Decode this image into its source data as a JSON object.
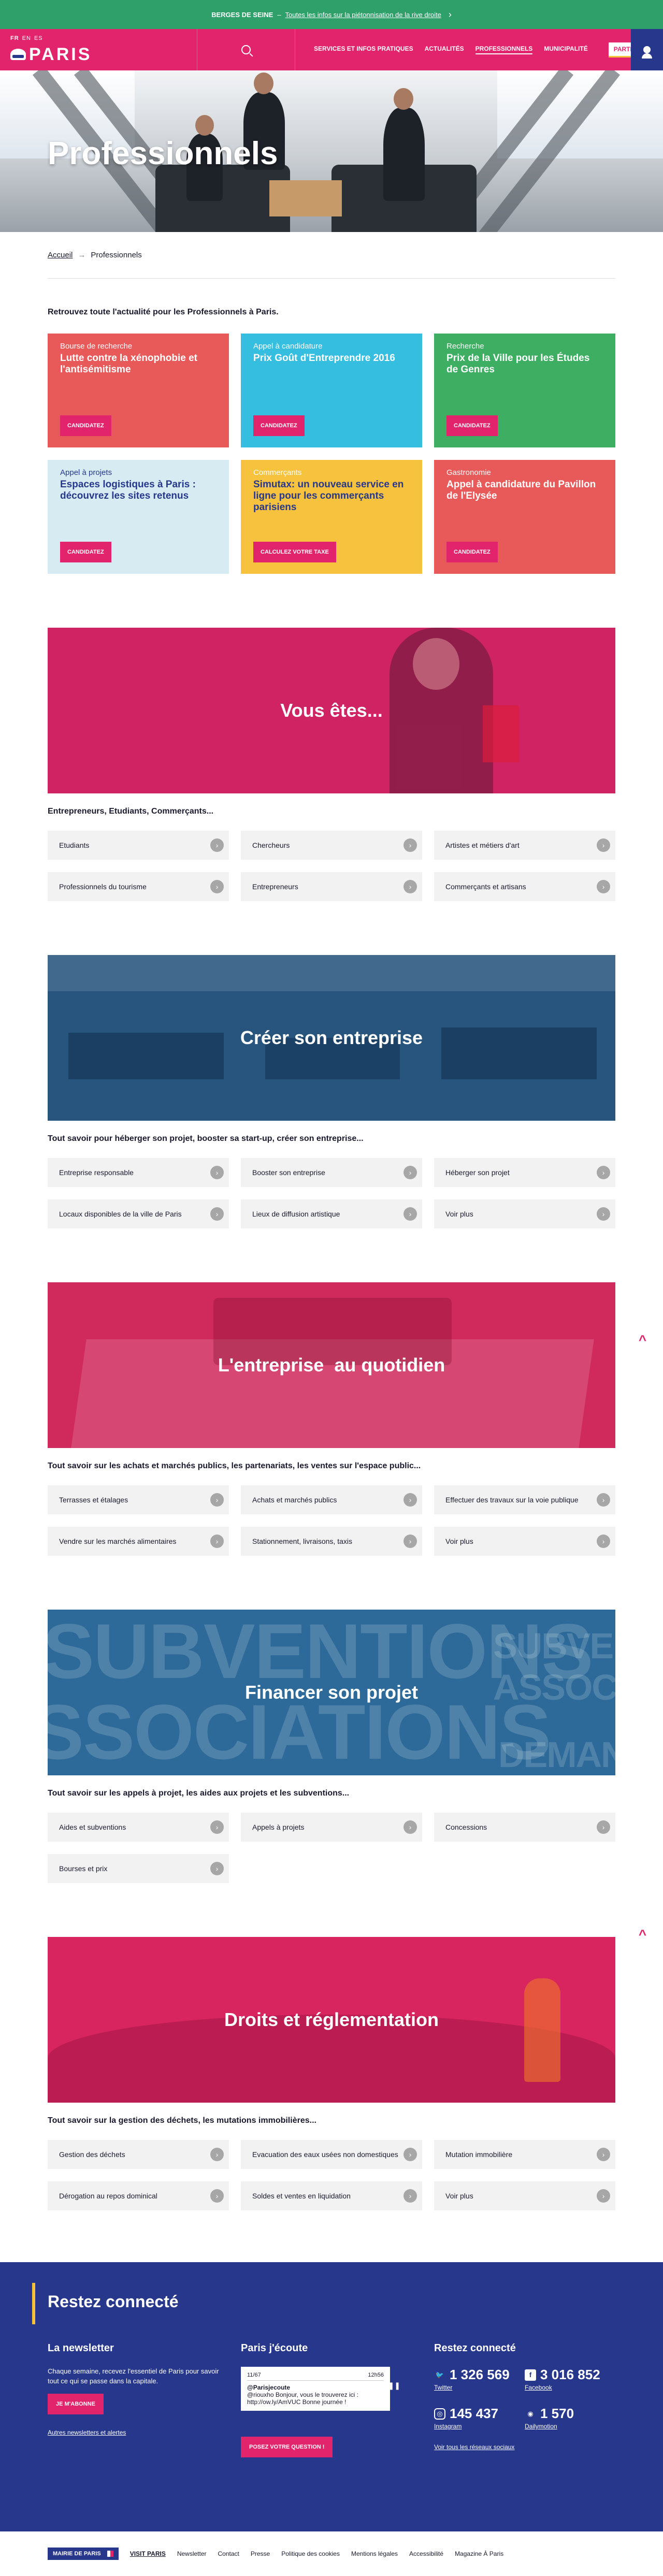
{
  "banner": {
    "strong": "BERGES DE SEINE",
    "sep": "–",
    "link": "Toutes les infos sur la piétonnisation de la rive droite"
  },
  "header": {
    "langs": [
      "FR",
      "EN",
      "ES"
    ],
    "logo": "PARIS",
    "nav": [
      "SERVICES ET INFOS PRATIQUES",
      "ACTUALITÉS",
      "PROFESSIONNELS",
      "MUNICIPALITÉ"
    ],
    "participez": "PARTICIPEZ !"
  },
  "hero": {
    "title": "Professionnels"
  },
  "breadcrumb": {
    "home": "Accueil",
    "arrow": "→",
    "current": "Professionnels"
  },
  "intro": "Retrouvez toute l'actualité pour les Professionnels à Paris.",
  "cards": [
    {
      "category": "Bourse de recherche",
      "title": "Lutte contre la xénophobie et l'antisémitisme",
      "button": "CANDIDATEZ",
      "color": "#e85a5a"
    },
    {
      "category": "Appel à candidature",
      "title": "Prix Goût d'Entreprendre 2016",
      "button": "CANDIDATEZ",
      "color": "#35bee0"
    },
    {
      "category": "Recherche",
      "title": "Prix de la Ville pour les Études de Genres",
      "button": "CANDIDATEZ",
      "color": "#3dae62"
    },
    {
      "category": "Appel à projets",
      "title": "Espaces logistiques à Paris : découvrez les sites retenus",
      "button": "CANDIDATEZ",
      "color": "#d6ecf2"
    },
    {
      "category": "Commerçants",
      "title": "Simutax: un nouveau service en ligne pour les commerçants parisiens",
      "button": "CALCULEZ VOTRE TAXE",
      "color": "#f7c33e"
    },
    {
      "category": "Gastronomie",
      "title": "Appel à candidature du Pavillon de l'Elysée",
      "button": "CANDIDATEZ",
      "color": "#e85a5a"
    }
  ],
  "sections": [
    {
      "title": "Vous êtes...",
      "desc": "Entrepreneurs, Etudiants, Commerçants...",
      "links": [
        "Etudiants",
        "Chercheurs",
        "Artistes et métiers d'art",
        "Professionnels du tourisme",
        "Entrepreneurs",
        "Commerçants et artisans"
      ]
    },
    {
      "title": "Créer son entreprise",
      "desc": "Tout savoir pour héberger son projet, booster sa start-up, créer son entreprise...",
      "links": [
        "Entreprise responsable",
        "Booster son entreprise",
        "Héberger son projet",
        "Locaux disponibles de la ville de Paris",
        "Lieux de diffusion artistique",
        "Voir plus"
      ]
    },
    {
      "title": "L'entreprise  au quotidien",
      "desc": "Tout savoir sur les achats et marchés publics, les partenariats, les ventes sur l'espace public...",
      "links": [
        "Terrasses et étalages",
        "Achats et marchés publics",
        "Effectuer des travaux sur la voie publique",
        "Vendre sur les marchés alimentaires",
        "Stationnement, livraisons, taxis",
        "Voir plus"
      ]
    },
    {
      "title": "Financer son projet",
      "desc": "Tout savoir sur les appels à projet, les aides aux projets et les subventions...",
      "links": [
        "Aides et subventions",
        "Appels à projets",
        "Concessions",
        "Bourses et prix"
      ],
      "overlay": [
        "SUBVENTIONS",
        "SSOCIATIONS",
        "SUBVENTI",
        "ASSOCIA",
        "DEMAND"
      ]
    },
    {
      "title": "Droits et réglementation",
      "desc": "Tout savoir sur la gestion des déchets, les mutations immobilières...",
      "links": [
        "Gestion des déchets",
        "Evacuation des eaux usées non domestiques",
        "Mutation immobilière",
        "Dérogation au repos dominical",
        "Soldes et ventes en liquidation",
        "Voir plus"
      ]
    }
  ],
  "footer": {
    "title": "Restez connecté",
    "newsletter": {
      "title": "La newsletter",
      "text": "Chaque semaine, recevez l'essentiel de Paris pour savoir tout ce qui se passe dans la capitale.",
      "button": "JE M'ABONNE",
      "link": "Autres newsletters et alertes"
    },
    "ecoute": {
      "title": "Paris j'écoute",
      "tweet_index": "11/67",
      "tweet_time": "12h56",
      "handle": "@Parisjecoute",
      "text": "@riouxho Bonjour, vous le trouverez ici : http://ow.ly/AmVUC Bonne journée !",
      "button": "POSEZ VOTRE QUESTION !"
    },
    "social": {
      "title": "Restez connecté",
      "items": [
        {
          "icon": "twitter-icon",
          "count": "1 326 569",
          "name": "Twitter"
        },
        {
          "icon": "facebook-icon",
          "count": "3 016 852",
          "name": "Facebook"
        },
        {
          "icon": "instagram-icon",
          "count": "145 437",
          "name": "Instagram"
        },
        {
          "icon": "dailymotion-icon",
          "count": "1 570",
          "name": "Dailymotion"
        }
      ],
      "all": "Voir tous les réseaux sociaux"
    }
  },
  "bottom": {
    "mairie": "MAIRIE DE PARIS",
    "links": [
      "VISIT PARIS",
      "Newsletter",
      "Contact",
      "Presse",
      "Politique des cookies",
      "Mentions légales",
      "Accessibilité",
      "Magazine À Paris"
    ]
  },
  "colors": {
    "pink": "#e1246c",
    "navy": "#27378b",
    "green": "#2fa06a",
    "yellow": "#f5c33b"
  }
}
